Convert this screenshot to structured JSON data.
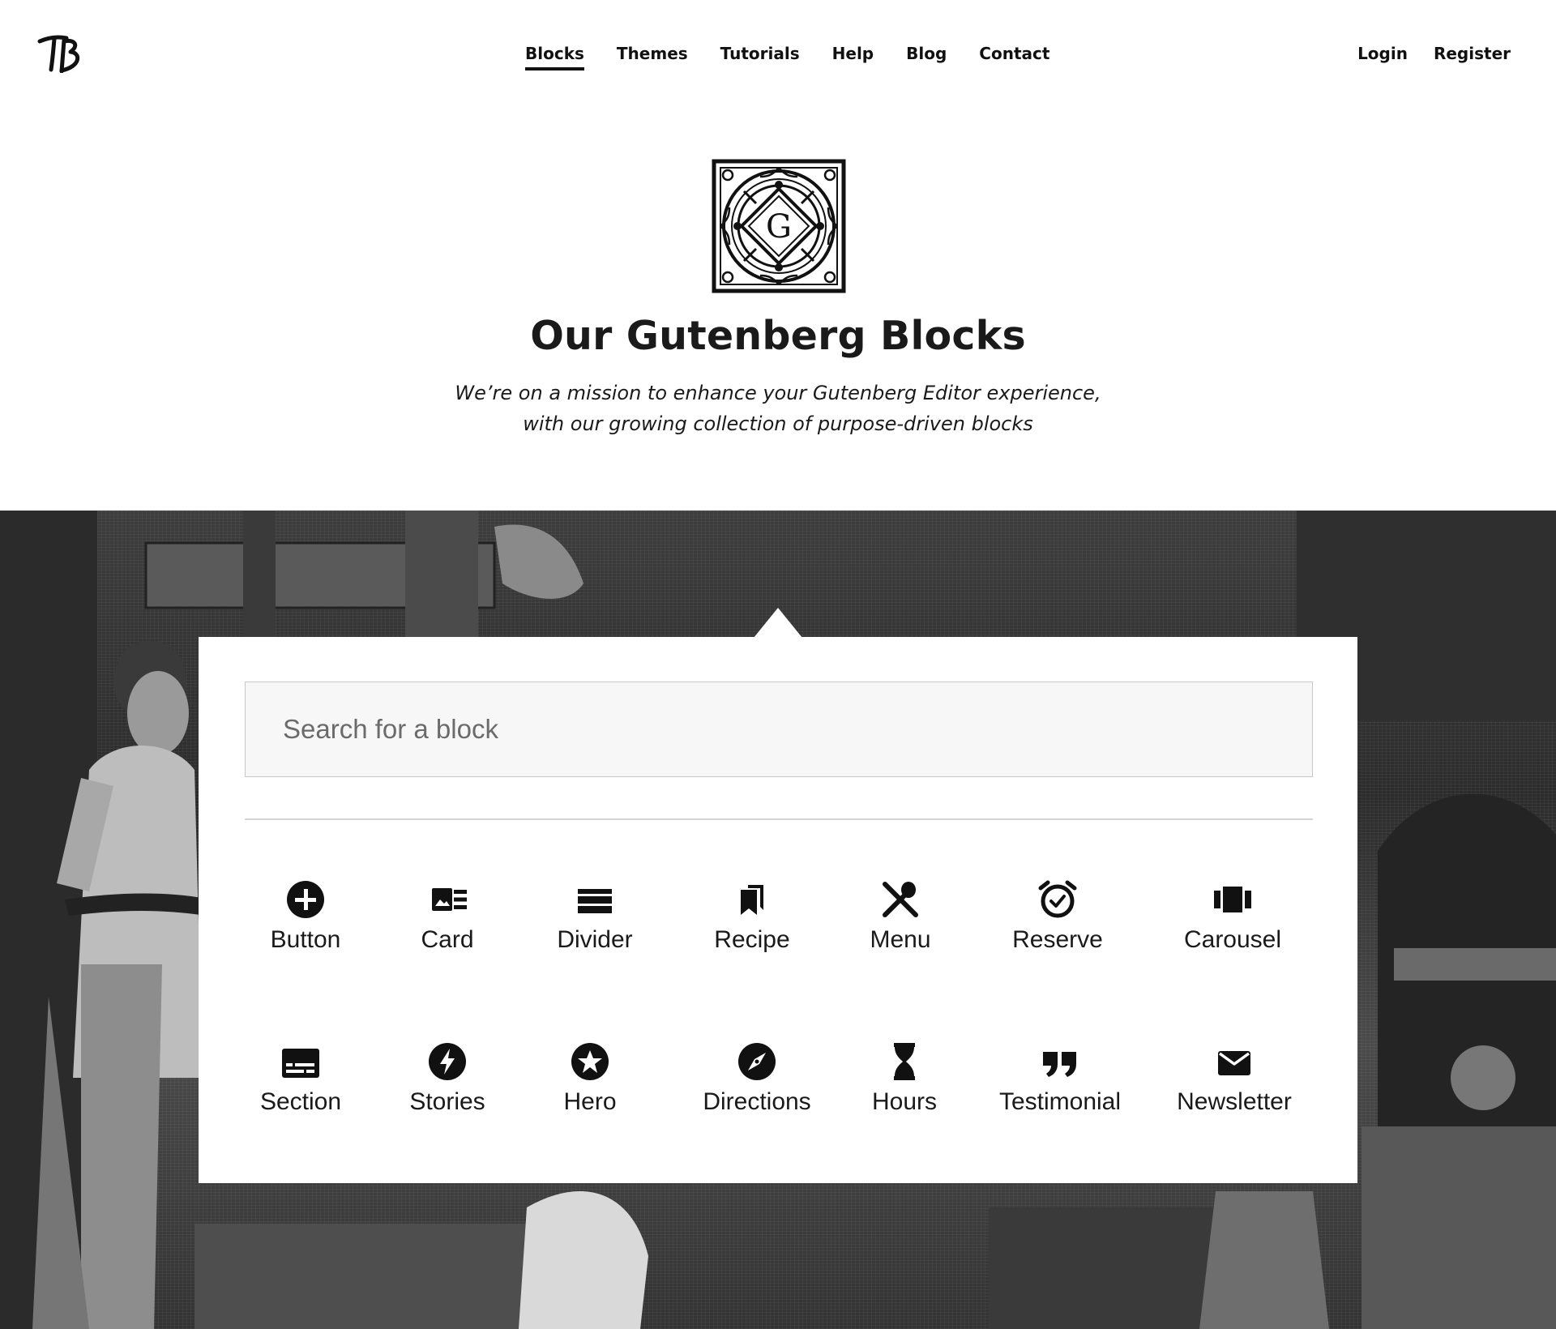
{
  "header": {
    "logo_text": "TB",
    "nav": [
      {
        "label": "Blocks",
        "active": true
      },
      {
        "label": "Themes",
        "active": false
      },
      {
        "label": "Tutorials",
        "active": false
      },
      {
        "label": "Help",
        "active": false
      },
      {
        "label": "Blog",
        "active": false
      },
      {
        "label": "Contact",
        "active": false
      }
    ],
    "login_label": "Login",
    "register_label": "Register"
  },
  "hero": {
    "emblem_letter": "G",
    "title": "Our Gutenberg Blocks",
    "subtitle_line1": "We’re on a mission to enhance your Gutenberg Editor experience,",
    "subtitle_line2": "with our growing collection of purpose-driven blocks"
  },
  "block_picker": {
    "search_placeholder": "Search for a block",
    "blocks": [
      {
        "label": "Button",
        "icon": "plus-circle-icon"
      },
      {
        "label": "Card",
        "icon": "card-icon"
      },
      {
        "label": "Divider",
        "icon": "divider-icon"
      },
      {
        "label": "Recipe",
        "icon": "recipe-bookmark-icon"
      },
      {
        "label": "Menu",
        "icon": "utensils-icon"
      },
      {
        "label": "Reserve",
        "icon": "alarm-clock-icon"
      },
      {
        "label": "Carousel",
        "icon": "carousel-icon"
      },
      {
        "label": "Section",
        "icon": "section-icon"
      },
      {
        "label": "Stories",
        "icon": "bolt-icon"
      },
      {
        "label": "Hero",
        "icon": "star-circle-icon"
      },
      {
        "label": "Directions",
        "icon": "compass-icon"
      },
      {
        "label": "Hours",
        "icon": "hourglass-icon"
      },
      {
        "label": "Testimonial",
        "icon": "quote-icon"
      },
      {
        "label": "Newsletter",
        "icon": "envelope-icon"
      }
    ]
  },
  "colors": {
    "text": "#1a1a1a",
    "panel": "#ffffff",
    "search_bg": "#f7f7f7"
  }
}
